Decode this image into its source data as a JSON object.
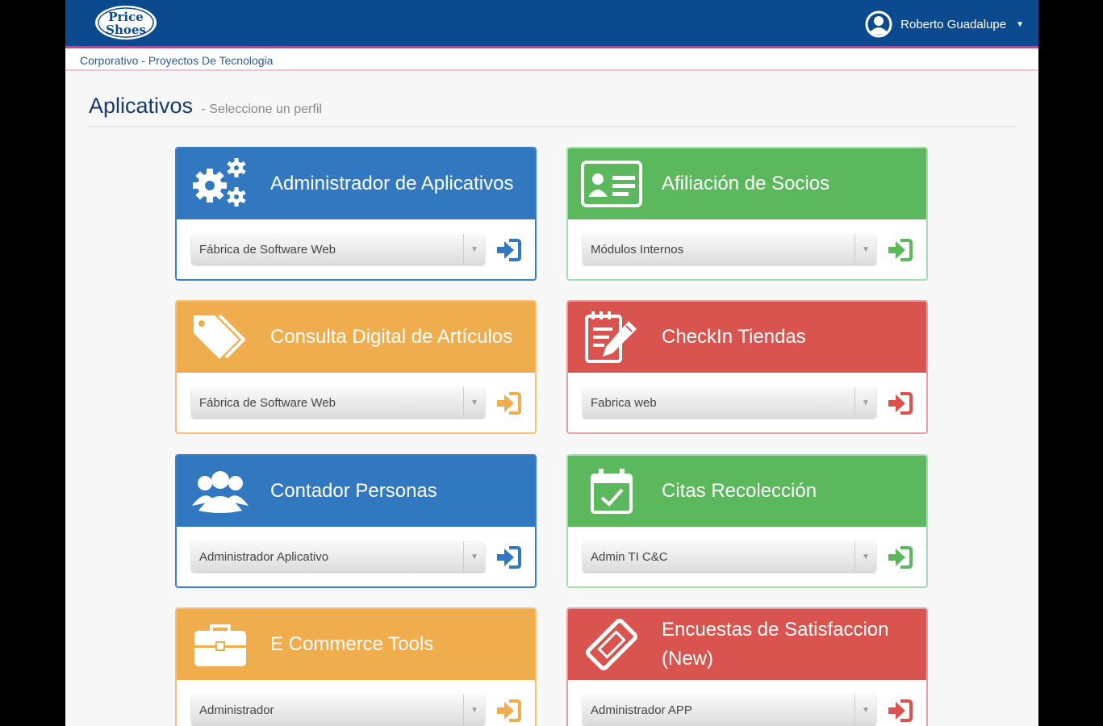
{
  "header": {
    "logo_text": [
      "Price",
      "Shoes"
    ],
    "user_name": "Roberto Guadalupe"
  },
  "breadcrumb": {
    "part1": "Corporativo",
    "separator": " - ",
    "part2": "Proyectos De Tecnologia"
  },
  "page": {
    "title": "Aplicativos",
    "subtitle": "- Seleccione un perfil"
  },
  "colors": {
    "blue": "#3178c0",
    "green": "#5cb85c",
    "orange": "#f0ad4e",
    "red": "#d9534f",
    "topbar": "#0b4a8f",
    "accent": "#e8338a"
  },
  "cards": [
    {
      "name": "Administrador de Aplicativos",
      "icon": "gears-icon",
      "color": "blue",
      "profile": "Fábrica de Software Web"
    },
    {
      "name": "Afiliación de Socios",
      "icon": "id-card-icon",
      "color": "green",
      "profile": "Módulos Internos"
    },
    {
      "name": "Consulta Digital de Artículos",
      "icon": "tags-icon",
      "color": "orange",
      "profile": "Fábrica de Software Web"
    },
    {
      "name": "CheckIn Tiendas",
      "icon": "pencil-notepad-icon",
      "color": "red",
      "profile": "Fabrica web"
    },
    {
      "name": "Contador Personas",
      "icon": "users-icon",
      "color": "blue",
      "profile": "Administrador Aplicativo"
    },
    {
      "name": "Citas Recolección",
      "icon": "calendar-check-icon",
      "color": "green",
      "profile": "Admin TI C&C"
    },
    {
      "name": "E Commerce Tools",
      "icon": "briefcase-icon",
      "color": "orange",
      "profile": "Administrador"
    },
    {
      "name": "Encuestas de Satisfaccion (New)",
      "icon": "ticket-icon",
      "color": "red",
      "profile": "Administrador APP"
    }
  ]
}
